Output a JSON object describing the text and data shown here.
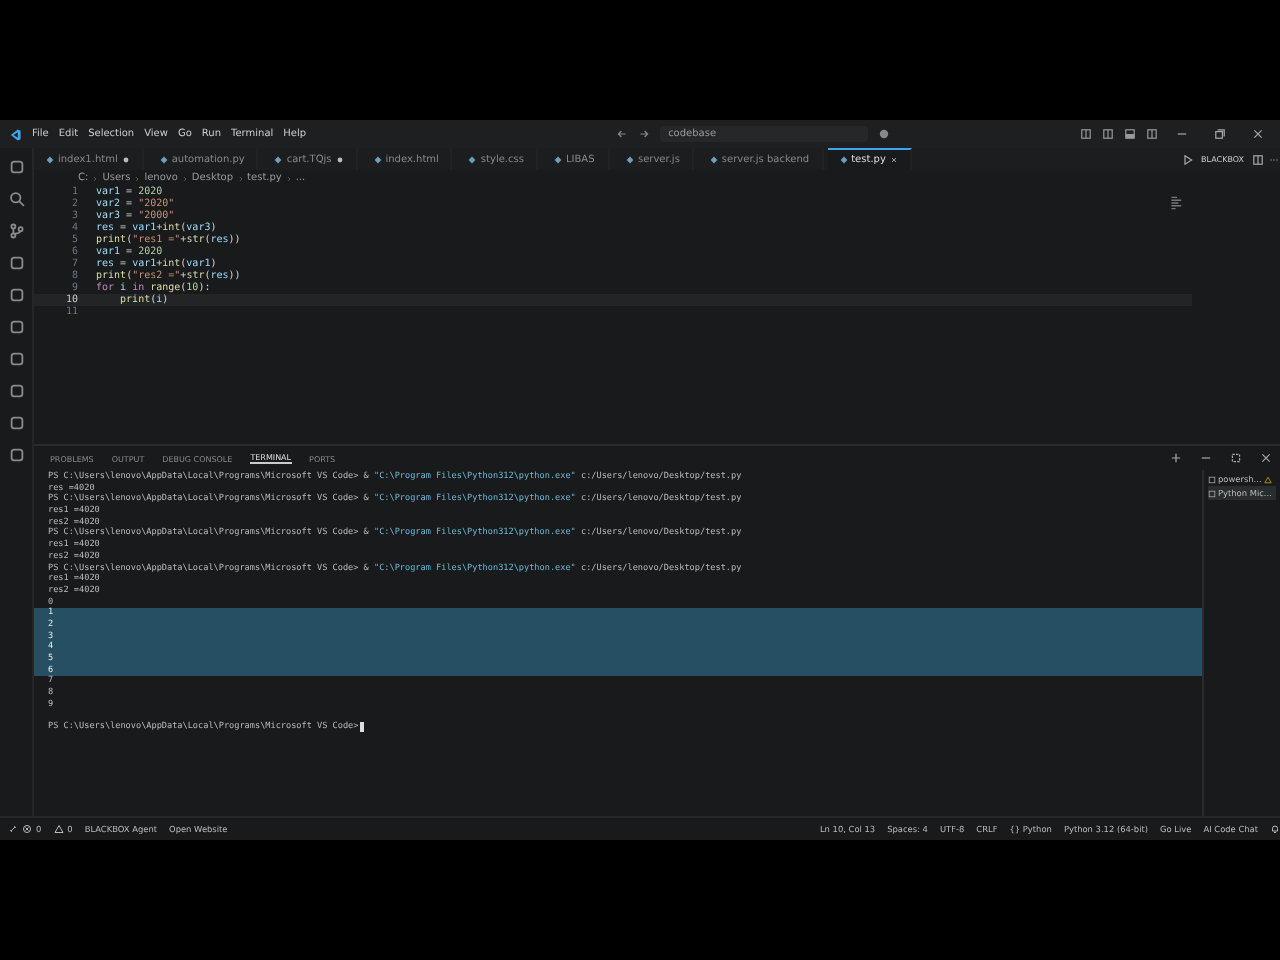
{
  "menu": [
    "File",
    "Edit",
    "Selection",
    "View",
    "Go",
    "Run",
    "Terminal",
    "Help"
  ],
  "search": {
    "value": "codebase"
  },
  "tabs": [
    {
      "label": "index1.html",
      "modified": true,
      "selected": false
    },
    {
      "label": "automation.py",
      "modified": false,
      "selected": false
    },
    {
      "label": "cart.TQjs",
      "modified": true,
      "selected": false
    },
    {
      "label": "index.html",
      "modified": false,
      "selected": false
    },
    {
      "label": "style.css",
      "modified": false,
      "selected": false
    },
    {
      "label": "LIBAS",
      "modified": false,
      "selected": false
    },
    {
      "label": "server.js",
      "modified": false,
      "selected": false
    },
    {
      "label": "server.js backend",
      "modified": false,
      "selected": false
    },
    {
      "label": "test.py",
      "modified": false,
      "selected": true
    }
  ],
  "editor_actions": {
    "label": "BLACKBOX"
  },
  "breadcrumb": [
    "C:",
    "Users",
    "lenovo",
    "Desktop",
    "test.py",
    "..."
  ],
  "code": [
    {
      "number": "1",
      "tokens": [
        {
          "text": "var1",
          "kind": "var"
        },
        {
          "text": " = ",
          "kind": "plain"
        },
        {
          "text": "2020",
          "kind": "num"
        }
      ]
    },
    {
      "number": "2",
      "tokens": [
        {
          "text": "var2",
          "kind": "var"
        },
        {
          "text": " = ",
          "kind": "plain"
        },
        {
          "text": "\"2020\"",
          "kind": "str"
        }
      ]
    },
    {
      "number": "3",
      "tokens": [
        {
          "text": "var3",
          "kind": "var"
        },
        {
          "text": " = ",
          "kind": "plain"
        },
        {
          "text": "\"2000\"",
          "kind": "str"
        }
      ]
    },
    {
      "number": "4",
      "tokens": [
        {
          "text": "res",
          "kind": "var"
        },
        {
          "text": " = ",
          "kind": "plain"
        },
        {
          "text": "var1",
          "kind": "var"
        },
        {
          "text": "+",
          "kind": "plain"
        },
        {
          "text": "int",
          "kind": "fn"
        },
        {
          "text": "(",
          "kind": "plain"
        },
        {
          "text": "var3",
          "kind": "var"
        },
        {
          "text": ")",
          "kind": "plain"
        }
      ]
    },
    {
      "number": "5",
      "tokens": [
        {
          "text": "print",
          "kind": "fn"
        },
        {
          "text": "(",
          "kind": "plain"
        },
        {
          "text": "\"res1 =\"",
          "kind": "str"
        },
        {
          "text": "+",
          "kind": "plain"
        },
        {
          "text": "str",
          "kind": "fn"
        },
        {
          "text": "(",
          "kind": "plain"
        },
        {
          "text": "res",
          "kind": "var"
        },
        {
          "text": "))",
          "kind": "plain"
        }
      ]
    },
    {
      "number": "6",
      "tokens": [
        {
          "text": "var1",
          "kind": "var"
        },
        {
          "text": " = ",
          "kind": "plain"
        },
        {
          "text": "2020",
          "kind": "num"
        }
      ]
    },
    {
      "number": "7",
      "tokens": [
        {
          "text": "res",
          "kind": "var"
        },
        {
          "text": " = ",
          "kind": "plain"
        },
        {
          "text": "var1",
          "kind": "var"
        },
        {
          "text": "+",
          "kind": "plain"
        },
        {
          "text": "int",
          "kind": "fn"
        },
        {
          "text": "(",
          "kind": "plain"
        },
        {
          "text": "var1",
          "kind": "var"
        },
        {
          "text": ")",
          "kind": "plain"
        }
      ]
    },
    {
      "number": "8",
      "tokens": [
        {
          "text": "print",
          "kind": "fn"
        },
        {
          "text": "(",
          "kind": "plain"
        },
        {
          "text": "\"res2 =\"",
          "kind": "str"
        },
        {
          "text": "+",
          "kind": "plain"
        },
        {
          "text": "str",
          "kind": "fn"
        },
        {
          "text": "(",
          "kind": "plain"
        },
        {
          "text": "res",
          "kind": "var"
        },
        {
          "text": "))",
          "kind": "plain"
        }
      ]
    },
    {
      "number": "9",
      "tokens": [
        {
          "text": "for",
          "kind": "kw"
        },
        {
          "text": " i ",
          "kind": "var"
        },
        {
          "text": "in",
          "kind": "kw"
        },
        {
          "text": " range",
          "kind": "fn"
        },
        {
          "text": "(",
          "kind": "plain"
        },
        {
          "text": "10",
          "kind": "num"
        },
        {
          "text": "):",
          "kind": "plain"
        }
      ]
    },
    {
      "number": "10",
      "current": true,
      "tokens": [
        {
          "text": "    print",
          "kind": "fn"
        },
        {
          "text": "(",
          "kind": "plain"
        },
        {
          "text": "i",
          "kind": "var"
        },
        {
          "text": ")",
          "kind": "plain"
        }
      ]
    },
    {
      "number": "11"
    }
  ],
  "panel_tabs": [
    {
      "label": "PROBLEMS",
      "selected": false
    },
    {
      "label": "OUTPUT",
      "selected": false
    },
    {
      "label": "DEBUG CONSOLE",
      "selected": false
    },
    {
      "label": "TERMINAL",
      "selected": true
    },
    {
      "label": "PORTS",
      "selected": false
    }
  ],
  "terminal": [
    {
      "kind": "cmd",
      "prompt": "PS C:\\Users\\lenovo\\AppData\\Local\\Programs\\Microsoft VS Code> & ",
      "path": "\"C:\\Program Files\\Python312\\python.exe\"",
      "arg": " c:/Users/lenovo/Desktop/test.py"
    },
    {
      "kind": "out",
      "text": "res =4020",
      "selected": false
    },
    {
      "kind": "cmd",
      "prompt": "PS C:\\Users\\lenovo\\AppData\\Local\\Programs\\Microsoft VS Code> & ",
      "path": "\"C:\\Program Files\\Python312\\python.exe\"",
      "arg": " c:/Users/lenovo/Desktop/test.py"
    },
    {
      "kind": "out",
      "text": "res1 =4020",
      "selected": false
    },
    {
      "kind": "out",
      "text": "res2 =4020",
      "selected": false
    },
    {
      "kind": "cmd",
      "prompt": "PS C:\\Users\\lenovo\\AppData\\Local\\Programs\\Microsoft VS Code> & ",
      "path": "\"C:\\Program Files\\Python312\\python.exe\"",
      "arg": " c:/Users/lenovo/Desktop/test.py"
    },
    {
      "kind": "out",
      "text": "res1 =4020",
      "selected": false
    },
    {
      "kind": "out",
      "text": "res2 =4020",
      "selected": false
    },
    {
      "kind": "cmd",
      "prompt": "PS C:\\Users\\lenovo\\AppData\\Local\\Programs\\Microsoft VS Code> & ",
      "path": "\"C:\\Program Files\\Python312\\python.exe\"",
      "arg": " c:/Users/lenovo/Desktop/test.py"
    },
    {
      "kind": "out",
      "text": "res1 =4020",
      "selected": false
    },
    {
      "kind": "out",
      "text": "res2 =4020",
      "selected": false
    },
    {
      "kind": "out",
      "text": "0",
      "selected": false
    },
    {
      "kind": "out",
      "text": "1",
      "selected": true
    },
    {
      "kind": "out",
      "text": "2",
      "selected": true
    },
    {
      "kind": "out",
      "text": "3",
      "selected": true
    },
    {
      "kind": "out",
      "text": "4",
      "selected": true
    },
    {
      "kind": "out",
      "text": "5",
      "selected": true
    },
    {
      "kind": "out",
      "text": "6",
      "selected": true
    },
    {
      "kind": "out",
      "text": "7",
      "selected": false
    },
    {
      "kind": "out",
      "text": "8",
      "selected": false
    },
    {
      "kind": "out",
      "text": "9",
      "selected": false
    },
    {
      "kind": "prompt",
      "prompt": "PS C:\\Users\\lenovo\\AppData\\Local\\Programs\\Microsoft VS Code> "
    }
  ],
  "terminal_list": [
    {
      "label": "powersh...",
      "selected": false,
      "warning": true
    },
    {
      "label": "Python Mic...",
      "selected": true,
      "warning": false
    }
  ],
  "status_left": [
    {
      "kind": "problems",
      "errors": "0",
      "warnings": "0"
    },
    {
      "kind": "text",
      "label": "BLACKBOX Agent"
    },
    {
      "kind": "text",
      "label": "Open Website"
    }
  ],
  "status_right": [
    "Ln 10, Col 13",
    "Spaces: 4",
    "UTF-8",
    "CRLF",
    "{} Python",
    "Python 3.12 (64-bit)",
    "Go Live",
    "AI Code Chat"
  ]
}
